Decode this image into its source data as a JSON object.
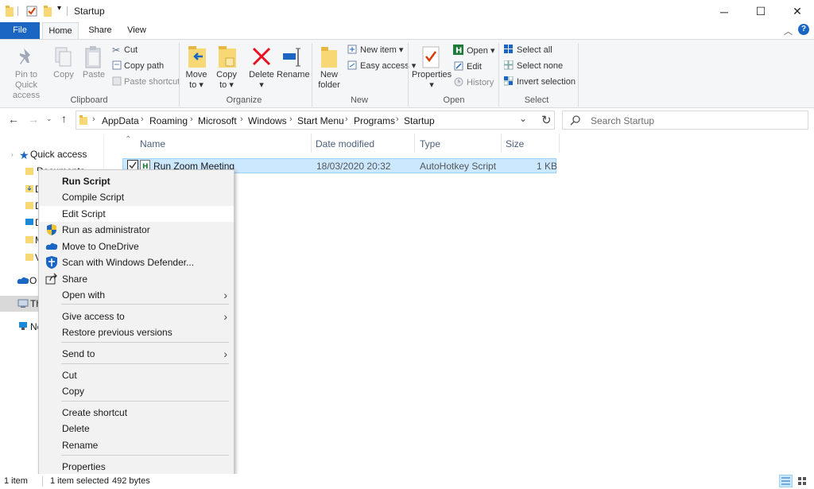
{
  "window": {
    "title": "Startup"
  },
  "tabs": {
    "file": "File",
    "home": "Home",
    "share": "Share",
    "view": "View"
  },
  "ribbon": {
    "clipboard": {
      "pin_line1": "Pin to Quick",
      "pin_line2": "access",
      "copy": "Copy",
      "paste": "Paste",
      "cut": "Cut",
      "copy_path": "Copy path",
      "paste_shortcut": "Paste shortcut",
      "group": "Clipboard"
    },
    "organize": {
      "move_line1": "Move",
      "move_line2": "to",
      "copy_line1": "Copy",
      "copy_line2": "to",
      "delete": "Delete",
      "rename": "Rename",
      "group": "Organize"
    },
    "new": {
      "folder_line1": "New",
      "folder_line2": "folder",
      "new_item": "New item",
      "easy_access": "Easy access",
      "group": "New"
    },
    "open": {
      "properties": "Properties",
      "open": "Open",
      "edit": "Edit",
      "history": "History",
      "group": "Open"
    },
    "select": {
      "select_all": "Select all",
      "select_none": "Select none",
      "invert": "Invert selection",
      "group": "Select"
    }
  },
  "address": {
    "crumbs": [
      "AppData",
      "Roaming",
      "Microsoft",
      "Windows",
      "Start Menu",
      "Programs",
      "Startup"
    ],
    "search_placeholder": "Search Startup"
  },
  "columns": {
    "name": "Name",
    "date": "Date modified",
    "type": "Type",
    "size": "Size"
  },
  "files": [
    {
      "name": "Run Zoom Meeting",
      "date": "18/03/2020 20:32",
      "type": "AutoHotkey Script",
      "size": "1 KB"
    }
  ],
  "nav": {
    "quick_access": "Quick access",
    "documents": "Documents",
    "items_partial": [
      "D",
      "D",
      "P",
      "D",
      "M",
      "V"
    ],
    "onedrive": "O",
    "thispc": "Th",
    "network": "Ne"
  },
  "context_menu": {
    "run_script": "Run Script",
    "compile_script": "Compile Script",
    "edit_script": "Edit Script",
    "run_as_admin": "Run as administrator",
    "move_onedrive": "Move to OneDrive",
    "scan_defender": "Scan with Windows Defender...",
    "share": "Share",
    "open_with": "Open with",
    "give_access": "Give access to",
    "restore_versions": "Restore previous versions",
    "send_to": "Send to",
    "cut": "Cut",
    "copy": "Copy",
    "create_shortcut": "Create shortcut",
    "delete": "Delete",
    "rename": "Rename",
    "properties": "Properties"
  },
  "status": {
    "count": "1 item",
    "selected": "1 item selected",
    "size": "492 bytes"
  },
  "colors": {
    "accent": "#1a66c2",
    "selection": "#cce8ff",
    "delete_red": "#e81123"
  }
}
